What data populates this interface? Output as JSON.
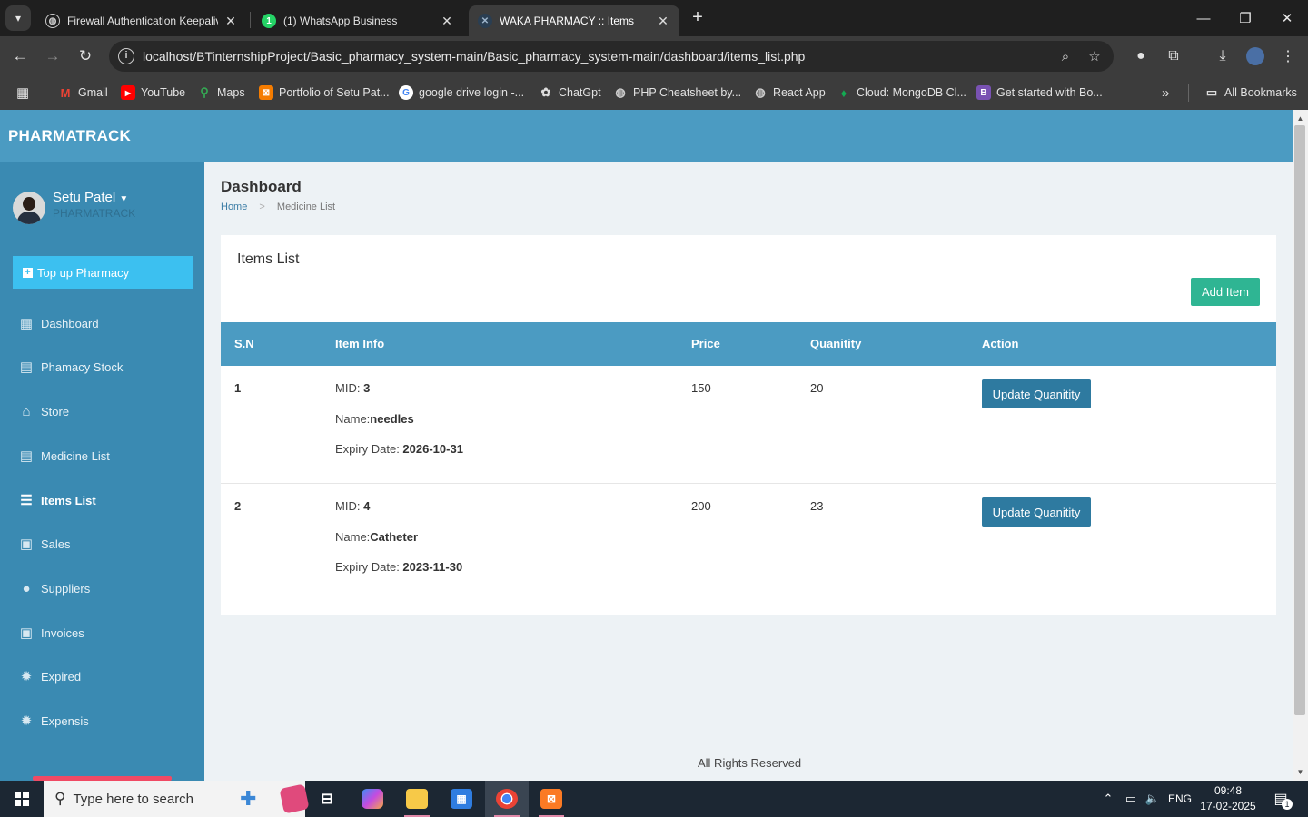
{
  "browser": {
    "tabs": [
      {
        "title": "Firewall Authentication Keepaliv",
        "icon": "globe-icon"
      },
      {
        "title": "(1) WhatsApp Business",
        "icon": "whatsapp-icon",
        "badge": "1"
      },
      {
        "title": "WAKA PHARMACY :: Items",
        "icon": "pharmacy-icon"
      }
    ],
    "url": "localhost/BTinternshipProject/Basic_pharmacy_system-main/Basic_pharmacy_system-main/dashboard/items_list.php",
    "bookmarks": [
      {
        "label": "Gmail",
        "icon": "gmail-icon"
      },
      {
        "label": "YouTube",
        "icon": "youtube-icon"
      },
      {
        "label": "Maps",
        "icon": "maps-icon"
      },
      {
        "label": "Portfolio of Setu Pat...",
        "icon": "portfolio-icon"
      },
      {
        "label": "google drive login -...",
        "icon": "google-icon"
      },
      {
        "label": "ChatGpt",
        "icon": "chatgpt-icon"
      },
      {
        "label": "PHP Cheatsheet by...",
        "icon": "globe-icon"
      },
      {
        "label": "React App",
        "icon": "globe-icon"
      },
      {
        "label": "Cloud: MongoDB Cl...",
        "icon": "mongodb-icon"
      },
      {
        "label": "Get started with Bo...",
        "icon": "bootstrap-icon"
      }
    ],
    "all_bookmarks": "All Bookmarks"
  },
  "app": {
    "brand": "PHARMATRACK",
    "user": {
      "name": "Setu Patel",
      "role": "PHARMATRACK"
    },
    "topup_label": "Top up Pharmacy",
    "nav": [
      {
        "label": "Dashboard",
        "icon": "dashboard-icon"
      },
      {
        "label": "Phamacy Stock",
        "icon": "clipboard-icon"
      },
      {
        "label": "Store",
        "icon": "home-icon"
      },
      {
        "label": "Medicine List",
        "icon": "clipboard-icon"
      },
      {
        "label": "Items List",
        "icon": "list-icon",
        "active": true
      },
      {
        "label": "Sales",
        "icon": "money-icon"
      },
      {
        "label": "Suppliers",
        "icon": "user-icon"
      },
      {
        "label": "Invoices",
        "icon": "money-icon"
      },
      {
        "label": "Expired",
        "icon": "certificate-icon"
      },
      {
        "label": "Expensis",
        "icon": "certificate-icon"
      }
    ],
    "page_title": "Dashboard",
    "breadcrumb": {
      "home": "Home",
      "current": "Medicine List"
    },
    "card_title": "Items List",
    "add_button": "Add Item",
    "columns": [
      "S.N",
      "Item Info",
      "Price",
      "Quanitity",
      "Action"
    ],
    "info_labels": {
      "mid": "MID: ",
      "name": "Name:",
      "expiry": "Expiry Date: "
    },
    "rows": [
      {
        "sn": "1",
        "mid": "3",
        "name": "needles",
        "expiry": "2026-10-31",
        "price": "150",
        "qty": "20",
        "action": "Update Quanitity"
      },
      {
        "sn": "2",
        "mid": "4",
        "name": "Catheter",
        "expiry": "2023-11-30",
        "price": "200",
        "qty": "23",
        "action": "Update Quanitity"
      }
    ],
    "footer": "All Rights Reserved"
  },
  "taskbar": {
    "search_placeholder": "Type here to search",
    "lang": "ENG",
    "time": "09:48",
    "date": "17-02-2025",
    "notification_count": "1"
  },
  "colors": {
    "header": "#4b9bc2",
    "sidebar": "#3a8ab2",
    "topup": "#3cc0f0",
    "add": "#2fb593",
    "update": "#2e7aa0"
  }
}
